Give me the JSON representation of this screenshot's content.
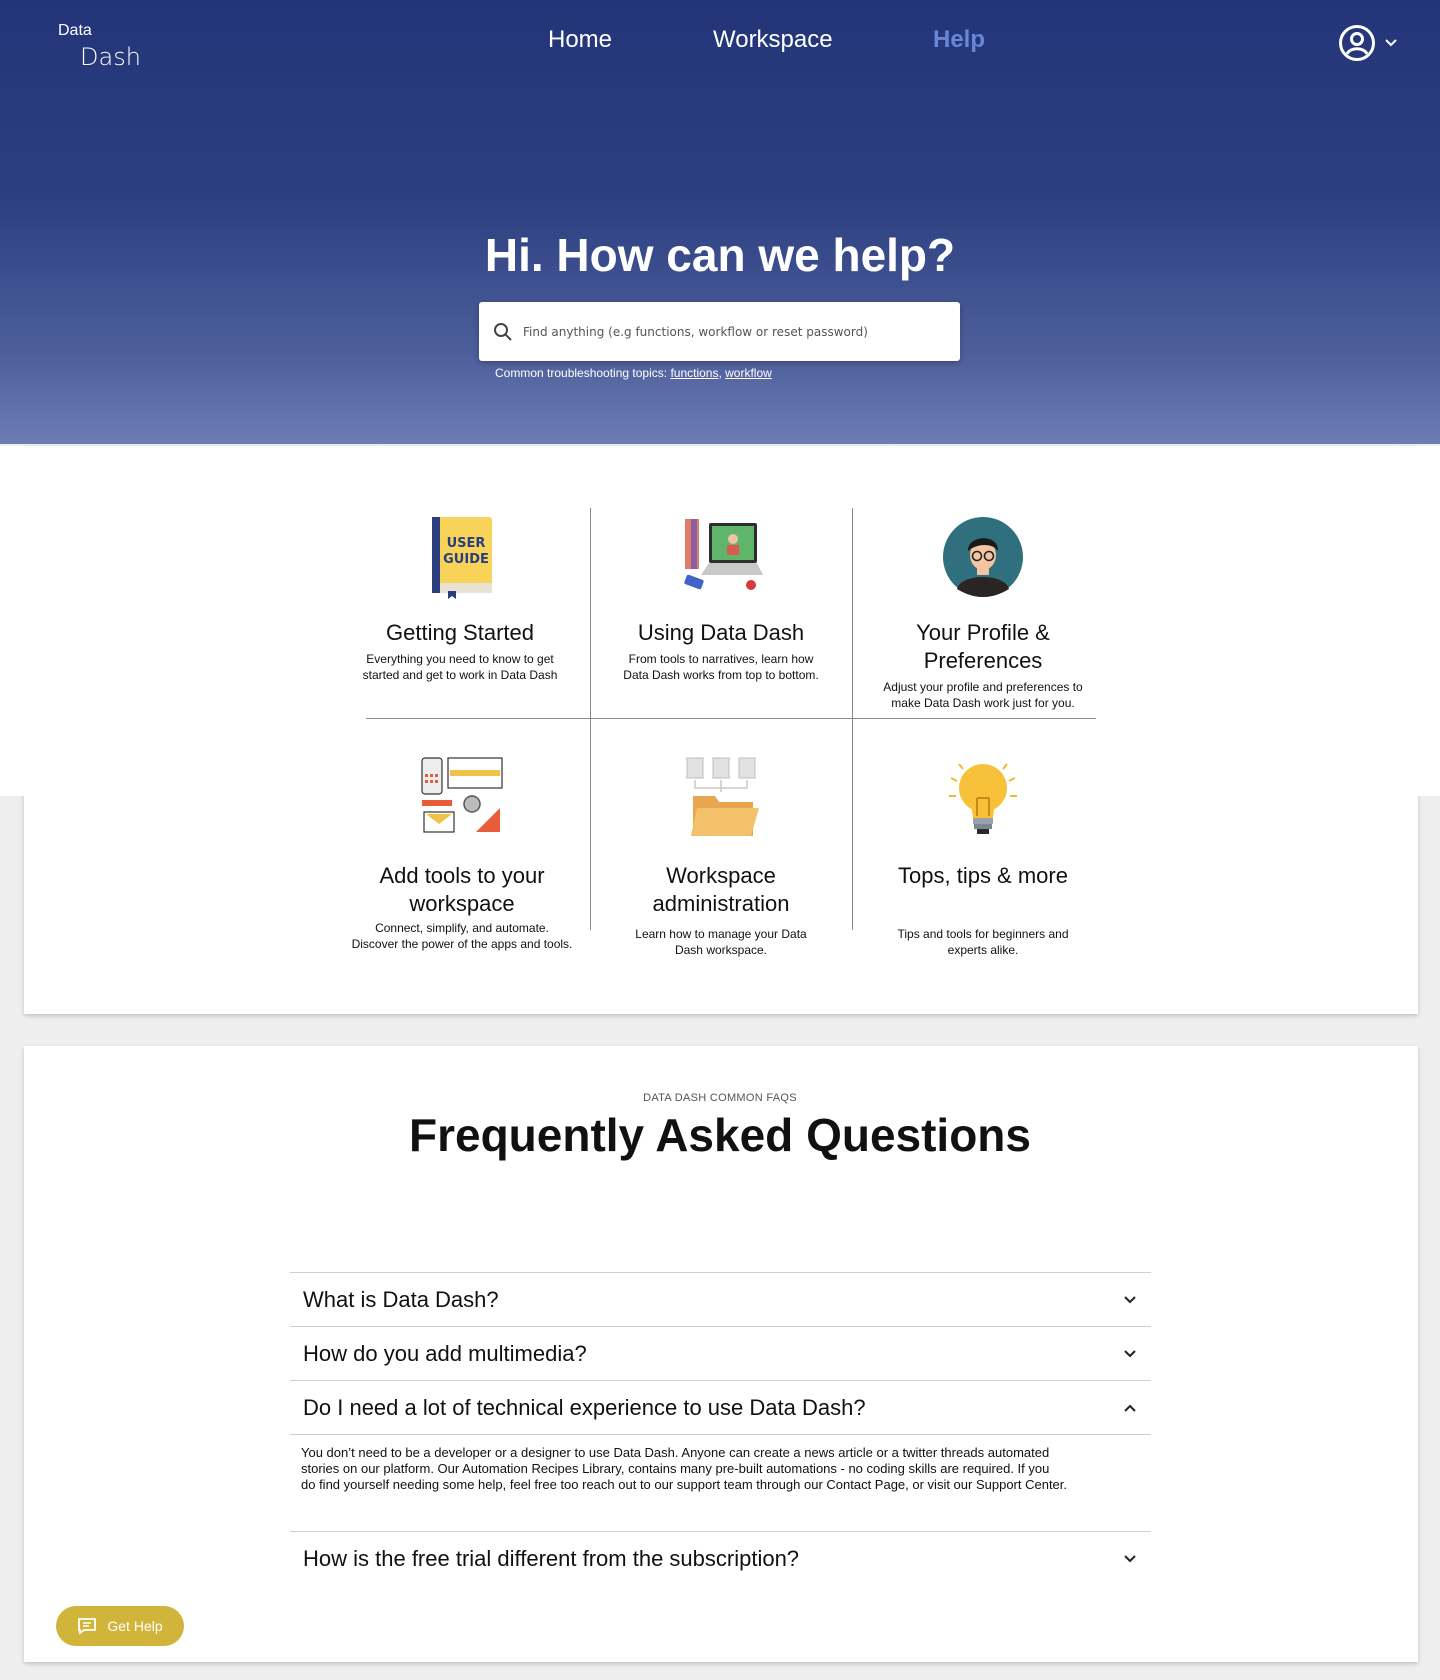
{
  "header": {
    "logo_line1": "Data",
    "logo_line2": "Dash",
    "nav": {
      "home": "Home",
      "workspace": "Workspace",
      "help": "Help"
    },
    "active_nav": "Help",
    "colors": {
      "hero_top": "#233578",
      "active_link": "#6a86d6"
    }
  },
  "hero": {
    "title": "Hi. How can we help?",
    "search_placeholder": "Find anything (e.g functions, workflow or reset password)",
    "topics_label": "Common troubleshooting topics:",
    "topic_links": [
      "functions",
      "workflow"
    ]
  },
  "categories": [
    {
      "title": "Getting  Started",
      "desc_lines": [
        "Everything you need to know to get",
        "started and get to work in Data Dash"
      ],
      "icon": "user-guide-book-icon"
    },
    {
      "title": "Using Data Dash",
      "desc_lines": [
        "From tools to narratives, learn how",
        "Data Dash works from top to bottom."
      ],
      "icon": "laptop-workstation-icon"
    },
    {
      "title_lines": [
        "Your Profile &",
        "Preferences"
      ],
      "desc_lines": [
        "Adjust your profile and preferences to",
        "make Data Dash work just for you."
      ],
      "icon": "profile-avatar-icon"
    },
    {
      "title_lines": [
        "Add tools to your",
        "workspace"
      ],
      "desc_lines": [
        "Connect, simplify, and automate.",
        "Discover the power of the apps and tools."
      ],
      "icon": "tools-collage-icon"
    },
    {
      "title_lines": [
        "Workspace",
        "administration"
      ],
      "desc_lines": [
        "Learn how to manage your Data",
        "Dash workspace."
      ],
      "icon": "folder-files-icon"
    },
    {
      "title": "Tops, tips & more",
      "desc_lines": [
        "Tips and tools for beginners and",
        "experts alike."
      ],
      "icon": "lightbulb-icon"
    }
  ],
  "faq": {
    "kicker": "DATA DASH COMMON FAQS",
    "title": "Frequently Asked Questions",
    "items": [
      {
        "q": "What is Data Dash?",
        "expanded": false
      },
      {
        "q": "How do you add multimedia?",
        "expanded": false
      },
      {
        "q": "Do I need a lot of technical experience to use Data Dash?",
        "expanded": true,
        "a_lines": [
          "You don’t need to be a developer or a designer to use  Data Dash. Anyone can create  a news article or a twitter threads automated",
          "stories on our platform. Our Automation Recipes Library, contains many pre-built automations - no coding skills are required. If you",
          "do find yourself needing some help, feel free too reach out to our support team through our Contact Page, or visit our Support Center."
        ]
      },
      {
        "q": "How is the free trial different from the subscription?",
        "expanded": false
      }
    ]
  },
  "help_button": {
    "label": "Get Help",
    "color": "#d1b53a"
  }
}
